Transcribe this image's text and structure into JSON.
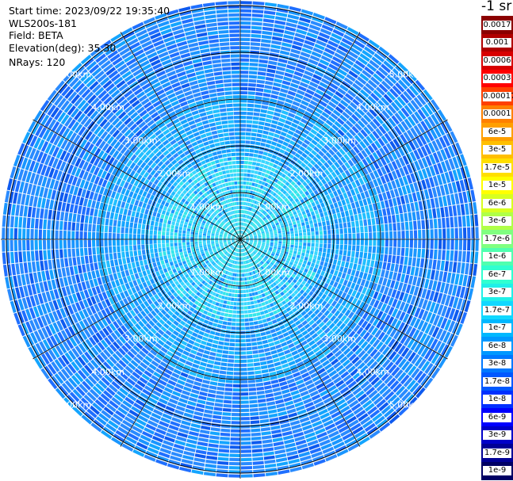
{
  "header": {
    "start_time": "Start time: 2023/09/22 19:35:40",
    "site": "WLS200s-181",
    "field": "Field: BETA",
    "elevation": "Elevation(deg): 35.30",
    "nrays": "NRays: 120"
  },
  "colorbar": {
    "unit": "-1 sr",
    "labels": [
      "0.0017",
      "0.001",
      "0.0006",
      "0.0003",
      "0.00017",
      "0.0001",
      "6e-5",
      "3e-5",
      "1.7e-5",
      "1e-5",
      "6e-6",
      "3e-6",
      "1.7e-6",
      "1e-6",
      "6e-7",
      "3e-7",
      "1.7e-7",
      "1e-7",
      "6e-8",
      "3e-8",
      "1.7e-8",
      "1e-8",
      "6e-9",
      "3e-9",
      "1.7e-9",
      "1e-9"
    ],
    "colors": [
      "#8b0000",
      "#b00000",
      "#d80000",
      "#ff0000",
      "#ff4000",
      "#ff8000",
      "#ff9f00",
      "#ffbf00",
      "#ffdf00",
      "#ffff00",
      "#d8ff20",
      "#b0ff48",
      "#80ff80",
      "#50ffaf",
      "#30ffd0",
      "#20f0e8",
      "#10d8ff",
      "#00b8ff",
      "#0098ff",
      "#0078ff",
      "#0058ff",
      "#0030ff",
      "#0000ff",
      "#0000c8",
      "#000096",
      "#000064"
    ]
  },
  "chart_data": {
    "type": "heatmap",
    "projection": "polar (PPI)",
    "field": "BETA",
    "elevation_deg": 35.3,
    "n_rays": 120,
    "range_rings_km": [
      1,
      2,
      3,
      4,
      5
    ],
    "ring_labels": [
      "1.00km",
      "2.00km",
      "3.00km",
      "4.00km",
      "5.00km"
    ],
    "color_scale": "log",
    "value_range": [
      1e-09,
      0.0017
    ]
  }
}
